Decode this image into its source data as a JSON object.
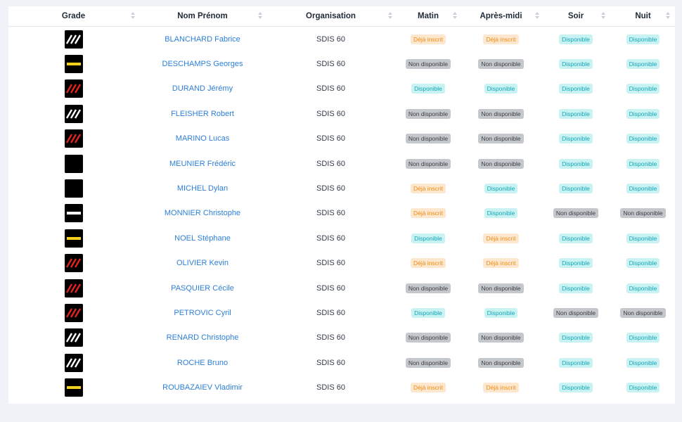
{
  "headers": {
    "grade": "Grade",
    "name": "Nom Prénom",
    "org": "Organisation",
    "matin": "Matin",
    "apres": "Après-midi",
    "soir": "Soir",
    "nuit": "Nuit"
  },
  "colors": {
    "dispo_bg": "#c9f3f2",
    "dispo_text": "#14a6b8",
    "non_bg": "#c4c7cc",
    "non_text": "#3b3f46",
    "inscrit_bg": "#fde8cf",
    "inscrit_text": "#ef8b12",
    "link": "#2d7fd8"
  },
  "rows": [
    {
      "grade": "white-stripes-icon",
      "name": "BLANCHARD Fabrice",
      "org": "SDIS 60",
      "slots": [
        "Déjà inscrit",
        "Déjà inscrit",
        "Disponible",
        "Disponible"
      ]
    },
    {
      "grade": "yellow-bar-icon",
      "name": "DESCHAMPS Georges",
      "org": "SDIS 60",
      "slots": [
        "Non disponible",
        "Non disponible",
        "Disponible",
        "Disponible"
      ]
    },
    {
      "grade": "red-stripes-icon",
      "name": "DURAND Jérémy",
      "org": "SDIS 60",
      "slots": [
        "Disponible",
        "Disponible",
        "Disponible",
        "Disponible"
      ]
    },
    {
      "grade": "white-stripes-icon",
      "name": "FLEISHER Robert",
      "org": "SDIS 60",
      "slots": [
        "Non disponible",
        "Non disponible",
        "Disponible",
        "Disponible"
      ]
    },
    {
      "grade": "red-stripes-icon",
      "name": "MARINO Lucas",
      "org": "SDIS 60",
      "slots": [
        "Non disponible",
        "Non disponible",
        "Disponible",
        "Disponible"
      ]
    },
    {
      "grade": "blank-icon",
      "name": "MEUNIER Frédéric",
      "org": "SDIS 60",
      "slots": [
        "Non disponible",
        "Non disponible",
        "Disponible",
        "Disponible"
      ]
    },
    {
      "grade": "blank-icon",
      "name": "MICHEL Dylan",
      "org": "SDIS 60",
      "slots": [
        "Déjà inscrit",
        "Disponible",
        "Disponible",
        "Disponible"
      ]
    },
    {
      "grade": "white-bar-icon",
      "name": "MONNIER Christophe",
      "org": "SDIS 60",
      "slots": [
        "Déjà inscrit",
        "Disponible",
        "Non disponible",
        "Non disponible"
      ]
    },
    {
      "grade": "yellow-bar-icon",
      "name": "NOEL Stéphane",
      "org": "SDIS 60",
      "slots": [
        "Disponible",
        "Déjà inscrit",
        "Disponible",
        "Disponible"
      ]
    },
    {
      "grade": "red-stripes-icon",
      "name": "OLIVIER Kevin",
      "org": "SDIS 60",
      "slots": [
        "Déjà inscrit",
        "Déjà inscrit",
        "Disponible",
        "Disponible"
      ]
    },
    {
      "grade": "red-stripes-icon",
      "name": "PASQUIER Cécile",
      "org": "SDIS 60",
      "slots": [
        "Non disponible",
        "Non disponible",
        "Disponible",
        "Disponible"
      ]
    },
    {
      "grade": "red-stripes-icon",
      "name": "PETROVIC Cyril",
      "org": "SDIS 60",
      "slots": [
        "Disponible",
        "Disponible",
        "Non disponible",
        "Non disponible"
      ]
    },
    {
      "grade": "white-stripes-icon",
      "name": "RENARD Christophe",
      "org": "SDIS 60",
      "slots": [
        "Non disponible",
        "Non disponible",
        "Disponible",
        "Disponible"
      ]
    },
    {
      "grade": "white-stripes-icon",
      "name": "ROCHE Bruno",
      "org": "SDIS 60",
      "slots": [
        "Non disponible",
        "Non disponible",
        "Disponible",
        "Disponible"
      ]
    },
    {
      "grade": "yellow-bar-icon",
      "name": "ROUBAZAIEV Vladimir",
      "org": "SDIS 60",
      "slots": [
        "Déjà inscrit",
        "Déjà inscrit",
        "Disponible",
        "Disponible"
      ]
    }
  ]
}
